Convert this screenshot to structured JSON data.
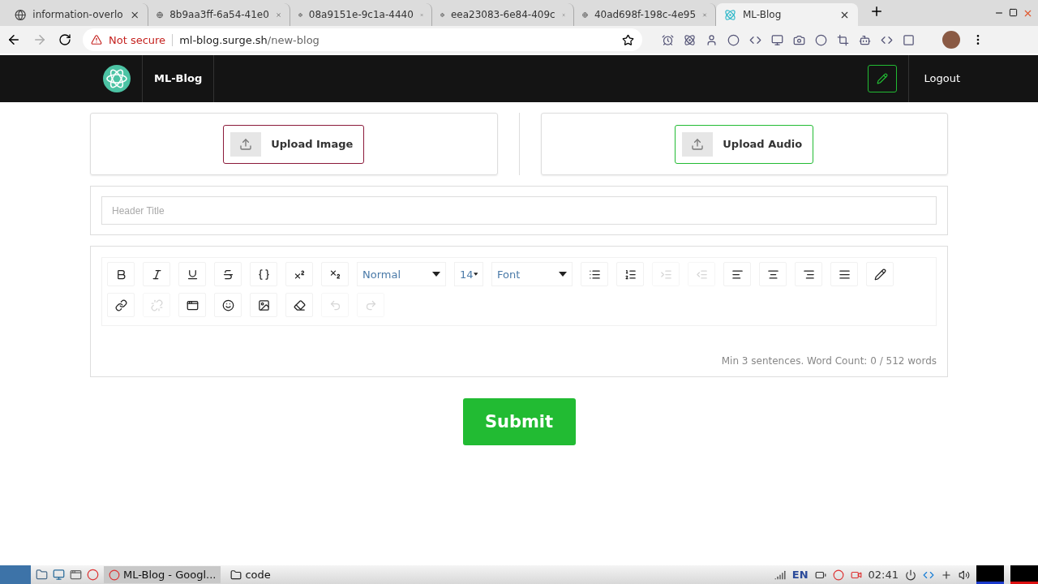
{
  "browser": {
    "tabs": [
      {
        "title": "information-overlo",
        "selected": false
      },
      {
        "title": "8b9aa3ff-6a54-41e0",
        "selected": false
      },
      {
        "title": "08a9151e-9c1a-4440",
        "selected": false
      },
      {
        "title": "eea23083-6e84-409c",
        "selected": false
      },
      {
        "title": "40ad698f-198c-4e95",
        "selected": false
      },
      {
        "title": "ML-Blog",
        "selected": true
      }
    ],
    "address": {
      "security": "Not secure",
      "host": "ml-blog.surge.sh",
      "path": "/new-blog"
    }
  },
  "navbar": {
    "brand": "ML-Blog",
    "logout": "Logout"
  },
  "uploads": [
    {
      "label": "Upload Image",
      "color": "#8b1a3a"
    },
    {
      "label": "Upload Audio",
      "color": "#22bb33"
    }
  ],
  "header_field": {
    "placeholder": "Header Title"
  },
  "editor": {
    "format_buttons": [
      {
        "disabled": false
      },
      {
        "disabled": false
      },
      {
        "disabled": false
      },
      {
        "disabled": false
      },
      {
        "disabled": false
      },
      {
        "disabled": false
      },
      {
        "disabled": false
      }
    ],
    "selects": [
      {
        "value": "Normal"
      },
      {
        "value": "14"
      },
      {
        "value": "Font"
      }
    ],
    "list_buttons": [
      {
        "disabled": false
      },
      {
        "disabled": false
      },
      {
        "disabled": true
      },
      {
        "disabled": true
      },
      {
        "disabled": false
      },
      {
        "disabled": false
      },
      {
        "disabled": false
      },
      {
        "disabled": false
      },
      {
        "disabled": false
      }
    ],
    "second_row": [
      {
        "disabled": false
      },
      {
        "disabled": true
      },
      {
        "disabled": false
      },
      {
        "disabled": false
      },
      {
        "disabled": false
      },
      {
        "disabled": false
      },
      {
        "disabled": true
      },
      {
        "disabled": true
      }
    ],
    "word_count": "Min 3 sentences. Word Count: 0 / 512 words"
  },
  "submit": "Submit",
  "taskbar": {
    "windows": [
      {
        "title": "ML-Blog - Googl...",
        "selected": true
      },
      {
        "title": "code",
        "selected": false
      }
    ],
    "language": "EN",
    "clock": "02:41"
  }
}
